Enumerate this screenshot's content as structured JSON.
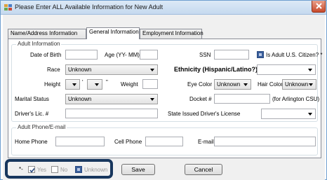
{
  "window": {
    "title": "Please Enter ALL Available Information for New Adult"
  },
  "tabs": [
    {
      "label": "Name/Address Information",
      "active": false
    },
    {
      "label": "General Information",
      "active": true
    },
    {
      "label": "Employment Information",
      "active": false
    }
  ],
  "adult_info": {
    "legend": "Adult Information",
    "dob_label": "Date of Birth",
    "dob_value": "",
    "age_label": "Age (YY- MM)",
    "age_value": "",
    "ssn_label": "SSN",
    "ssn_value": "",
    "citizen_label": "Is Adult U.S. Citizen? *",
    "race_label": "Race",
    "race_value": "Unknown",
    "ethnicity_label": "Ethnicity (Hispanic/Latino?)",
    "ethnicity_value": "",
    "height_label": "Height",
    "height_feet_value": "",
    "feet_mark": "'",
    "height_inches_value": "",
    "inch_mark": "\"",
    "weight_label": "Weight",
    "weight_value": "",
    "eye_label": "Eye Color",
    "eye_value": "Unknown",
    "hair_label": "Hair Color",
    "hair_value": "Unknown",
    "marital_label": "Marital Status",
    "marital_value": "Unknown",
    "docket_label": "Docket #",
    "docket_value": "",
    "docket_note": "(for Arlington CSU)",
    "dl_label": "Driver's Lic. #",
    "dl_value": "",
    "state_dl_label": "State Issued Driver's License",
    "state_dl_value": ""
  },
  "phone": {
    "legend": "Adult Phone/E-mail",
    "home_label": "Home Phone",
    "home_value": "",
    "cell_label": "Cell Phone",
    "cell_value": "",
    "email_label": "E-mail",
    "email_value": ""
  },
  "footer": {
    "asterisk": "*-",
    "yes_label": "Yes",
    "no_label": "No",
    "unknown_label": "Unknown",
    "save_label": "Save",
    "cancel_label": "Cancel"
  },
  "colors": {
    "highlight_border": "#17365d",
    "filled_checkbox": "#3a5f9c",
    "close_button": "#c84a2c"
  },
  "icons": [
    "app-icon",
    "close-icon",
    "checkmark-icon",
    "dropdown-arrow-icon"
  ]
}
